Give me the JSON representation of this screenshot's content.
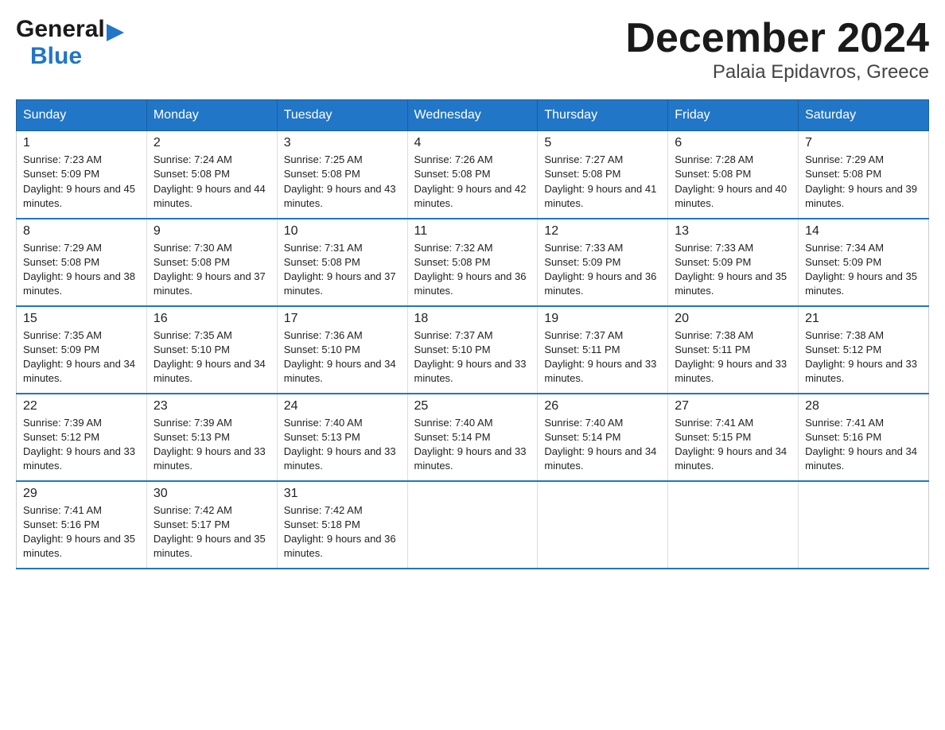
{
  "logo": {
    "general": "General",
    "blue": "Blue",
    "arrow": "▶"
  },
  "title": "December 2024",
  "subtitle": "Palaia Epidavros, Greece",
  "days_of_week": [
    "Sunday",
    "Monday",
    "Tuesday",
    "Wednesday",
    "Thursday",
    "Friday",
    "Saturday"
  ],
  "weeks": [
    [
      {
        "day": "1",
        "sunrise": "7:23 AM",
        "sunset": "5:09 PM",
        "daylight": "9 hours and 45 minutes."
      },
      {
        "day": "2",
        "sunrise": "7:24 AM",
        "sunset": "5:08 PM",
        "daylight": "9 hours and 44 minutes."
      },
      {
        "day": "3",
        "sunrise": "7:25 AM",
        "sunset": "5:08 PM",
        "daylight": "9 hours and 43 minutes."
      },
      {
        "day": "4",
        "sunrise": "7:26 AM",
        "sunset": "5:08 PM",
        "daylight": "9 hours and 42 minutes."
      },
      {
        "day": "5",
        "sunrise": "7:27 AM",
        "sunset": "5:08 PM",
        "daylight": "9 hours and 41 minutes."
      },
      {
        "day": "6",
        "sunrise": "7:28 AM",
        "sunset": "5:08 PM",
        "daylight": "9 hours and 40 minutes."
      },
      {
        "day": "7",
        "sunrise": "7:29 AM",
        "sunset": "5:08 PM",
        "daylight": "9 hours and 39 minutes."
      }
    ],
    [
      {
        "day": "8",
        "sunrise": "7:29 AM",
        "sunset": "5:08 PM",
        "daylight": "9 hours and 38 minutes."
      },
      {
        "day": "9",
        "sunrise": "7:30 AM",
        "sunset": "5:08 PM",
        "daylight": "9 hours and 37 minutes."
      },
      {
        "day": "10",
        "sunrise": "7:31 AM",
        "sunset": "5:08 PM",
        "daylight": "9 hours and 37 minutes."
      },
      {
        "day": "11",
        "sunrise": "7:32 AM",
        "sunset": "5:08 PM",
        "daylight": "9 hours and 36 minutes."
      },
      {
        "day": "12",
        "sunrise": "7:33 AM",
        "sunset": "5:09 PM",
        "daylight": "9 hours and 36 minutes."
      },
      {
        "day": "13",
        "sunrise": "7:33 AM",
        "sunset": "5:09 PM",
        "daylight": "9 hours and 35 minutes."
      },
      {
        "day": "14",
        "sunrise": "7:34 AM",
        "sunset": "5:09 PM",
        "daylight": "9 hours and 35 minutes."
      }
    ],
    [
      {
        "day": "15",
        "sunrise": "7:35 AM",
        "sunset": "5:09 PM",
        "daylight": "9 hours and 34 minutes."
      },
      {
        "day": "16",
        "sunrise": "7:35 AM",
        "sunset": "5:10 PM",
        "daylight": "9 hours and 34 minutes."
      },
      {
        "day": "17",
        "sunrise": "7:36 AM",
        "sunset": "5:10 PM",
        "daylight": "9 hours and 34 minutes."
      },
      {
        "day": "18",
        "sunrise": "7:37 AM",
        "sunset": "5:10 PM",
        "daylight": "9 hours and 33 minutes."
      },
      {
        "day": "19",
        "sunrise": "7:37 AM",
        "sunset": "5:11 PM",
        "daylight": "9 hours and 33 minutes."
      },
      {
        "day": "20",
        "sunrise": "7:38 AM",
        "sunset": "5:11 PM",
        "daylight": "9 hours and 33 minutes."
      },
      {
        "day": "21",
        "sunrise": "7:38 AM",
        "sunset": "5:12 PM",
        "daylight": "9 hours and 33 minutes."
      }
    ],
    [
      {
        "day": "22",
        "sunrise": "7:39 AM",
        "sunset": "5:12 PM",
        "daylight": "9 hours and 33 minutes."
      },
      {
        "day": "23",
        "sunrise": "7:39 AM",
        "sunset": "5:13 PM",
        "daylight": "9 hours and 33 minutes."
      },
      {
        "day": "24",
        "sunrise": "7:40 AM",
        "sunset": "5:13 PM",
        "daylight": "9 hours and 33 minutes."
      },
      {
        "day": "25",
        "sunrise": "7:40 AM",
        "sunset": "5:14 PM",
        "daylight": "9 hours and 33 minutes."
      },
      {
        "day": "26",
        "sunrise": "7:40 AM",
        "sunset": "5:14 PM",
        "daylight": "9 hours and 34 minutes."
      },
      {
        "day": "27",
        "sunrise": "7:41 AM",
        "sunset": "5:15 PM",
        "daylight": "9 hours and 34 minutes."
      },
      {
        "day": "28",
        "sunrise": "7:41 AM",
        "sunset": "5:16 PM",
        "daylight": "9 hours and 34 minutes."
      }
    ],
    [
      {
        "day": "29",
        "sunrise": "7:41 AM",
        "sunset": "5:16 PM",
        "daylight": "9 hours and 35 minutes."
      },
      {
        "day": "30",
        "sunrise": "7:42 AM",
        "sunset": "5:17 PM",
        "daylight": "9 hours and 35 minutes."
      },
      {
        "day": "31",
        "sunrise": "7:42 AM",
        "sunset": "5:18 PM",
        "daylight": "9 hours and 36 minutes."
      },
      {
        "day": "",
        "sunrise": "",
        "sunset": "",
        "daylight": ""
      },
      {
        "day": "",
        "sunrise": "",
        "sunset": "",
        "daylight": ""
      },
      {
        "day": "",
        "sunrise": "",
        "sunset": "",
        "daylight": ""
      },
      {
        "day": "",
        "sunrise": "",
        "sunset": "",
        "daylight": ""
      }
    ]
  ]
}
